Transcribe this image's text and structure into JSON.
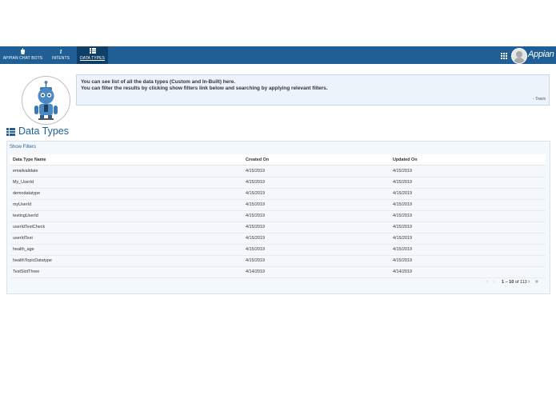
{
  "nav": {
    "tabs": [
      {
        "label": "APPIAN CHAT BOTS",
        "icon": "bot-icon"
      },
      {
        "label": "INTENTS",
        "icon": "italic-i-icon"
      },
      {
        "label": "DATA TYPES",
        "icon": "list-icon",
        "active": true
      }
    ],
    "logo": "Appian"
  },
  "message": {
    "line1": "You can see list of all the data types (Custom and In-Built) here.",
    "line2": "You can filter the results by clicking show filters link below and searching by applying relevant filters.",
    "signature": "- Travis"
  },
  "page": {
    "title": "Data Types",
    "show_filters": "Show Filters"
  },
  "table": {
    "columns": [
      "Data Type Name",
      "Created On",
      "Updated On"
    ],
    "rows": [
      [
        "emailvalidate",
        "4/15/2019",
        "4/15/2019"
      ],
      [
        "My_UserId",
        "4/15/2019",
        "4/15/2019"
      ],
      [
        "demodatatype",
        "4/15/2019",
        "4/15/2019"
      ],
      [
        "myUserId",
        "4/15/2019",
        "4/15/2019"
      ],
      [
        "testingUserId",
        "4/15/2019",
        "4/15/2019"
      ],
      [
        "userIdTestCheck",
        "4/15/2019",
        "4/15/2019"
      ],
      [
        "userIdTest",
        "4/15/2019",
        "4/15/2019"
      ],
      [
        "health_age",
        "4/15/2019",
        "4/15/2019"
      ],
      [
        "healthTopicDatatype",
        "4/15/2019",
        "4/15/2019"
      ],
      [
        "TestSlotThree",
        "4/14/2019",
        "4/14/2019"
      ]
    ]
  },
  "pager": {
    "range": "1 – 10",
    "of_text": "of 113"
  },
  "colors": {
    "brand": "#1f5f95",
    "navbar_active": "#0f3f66",
    "message_bg": "#edf3fb"
  }
}
